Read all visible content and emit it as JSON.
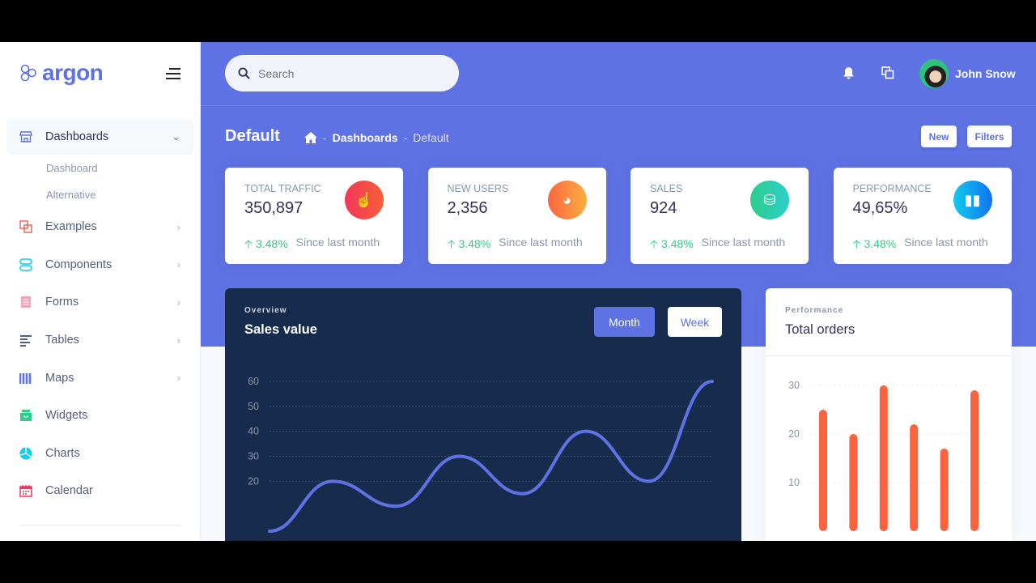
{
  "sidebar": {
    "brand": "argon",
    "items": [
      {
        "label": "Dashboards",
        "icon": "shop-icon",
        "color": "#5e72e4",
        "expanded": true,
        "subitems": [
          "Dashboard",
          "Alternative"
        ]
      },
      {
        "label": "Examples",
        "icon": "ungroup-icon",
        "color": "#f4645f",
        "chev": true
      },
      {
        "label": "Components",
        "icon": "ui-04-icon",
        "color": "#11cdef",
        "chev": true
      },
      {
        "label": "Forms",
        "icon": "single-copy-icon",
        "color": "#f3a4b5",
        "chev": true
      },
      {
        "label": "Tables",
        "icon": "align-left-icon",
        "color": "#172b4d",
        "chev": true
      },
      {
        "label": "Maps",
        "icon": "map-icon",
        "color": "#5e72e4",
        "chev": true
      },
      {
        "label": "Widgets",
        "icon": "archive-icon",
        "color": "#2dce89"
      },
      {
        "label": "Charts",
        "icon": "pie-chart-icon",
        "color": "#11cdef"
      },
      {
        "label": "Calendar",
        "icon": "calendar-icon",
        "color": "#f5365c"
      }
    ]
  },
  "header": {
    "search_placeholder": "Search",
    "user_name": "John Snow"
  },
  "page": {
    "title": "Default",
    "breadcrumb": [
      "Dashboards",
      "Default"
    ],
    "new_label": "New",
    "filters_label": "Filters"
  },
  "stats": [
    {
      "title": "Total traffic",
      "value": "350,897",
      "change": "3.48%",
      "since": "Since last month",
      "icon": "hand-pointer-icon",
      "gradient": [
        "#f5365c",
        "#f56036"
      ]
    },
    {
      "title": "New users",
      "value": "2,356",
      "change": "3.48%",
      "since": "Since last month",
      "icon": "chart-pie-icon",
      "gradient": [
        "#fb6340",
        "#fbb140"
      ]
    },
    {
      "title": "Sales",
      "value": "924",
      "change": "3.48%",
      "since": "Since last month",
      "icon": "money-coins-icon",
      "gradient": [
        "#2dce89",
        "#2dcecc"
      ]
    },
    {
      "title": "Performance",
      "value": "49,65%",
      "change": "3.48%",
      "since": "Since last month",
      "icon": "chart-bar-icon",
      "gradient": [
        "#11cdef",
        "#1171ef"
      ]
    }
  ],
  "overview": {
    "eyebrow": "Overview",
    "title": "Sales value",
    "month_label": "Month",
    "week_label": "Week"
  },
  "orders": {
    "eyebrow": "Performance",
    "title": "Total orders"
  },
  "chart_data": [
    {
      "type": "line",
      "title": "Sales value",
      "y": [
        0,
        20,
        10,
        30,
        15,
        40,
        20,
        60
      ],
      "ylim": [
        0,
        60
      ],
      "yticks": [
        60,
        50,
        40,
        30,
        20
      ],
      "grid": true,
      "color": "#5e72e4"
    },
    {
      "type": "bar",
      "title": "Total orders",
      "values": [
        25,
        20,
        30,
        22,
        17,
        29
      ],
      "ylim": [
        0,
        30
      ],
      "yticks": [
        30,
        20,
        10
      ],
      "grid": true,
      "color": "#fb6340"
    }
  ]
}
